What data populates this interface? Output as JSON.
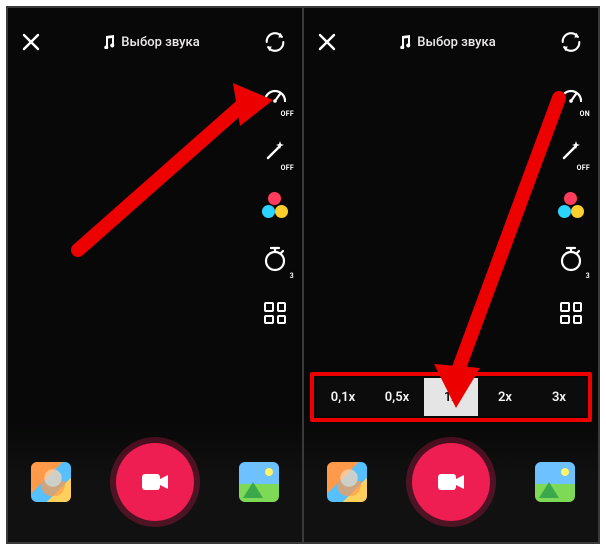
{
  "left": {
    "sound_label": "Выбор звука",
    "speed_sub": "OFF",
    "magic_sub": "OFF",
    "timer_sub": "3"
  },
  "right": {
    "sound_label": "Выбор звука",
    "speed_sub": "ON",
    "magic_sub": "OFF",
    "timer_sub": "3",
    "speeds": [
      "0,1x",
      "0,5x",
      "1x",
      "2x",
      "3x"
    ],
    "speed_selected_index": 2
  }
}
